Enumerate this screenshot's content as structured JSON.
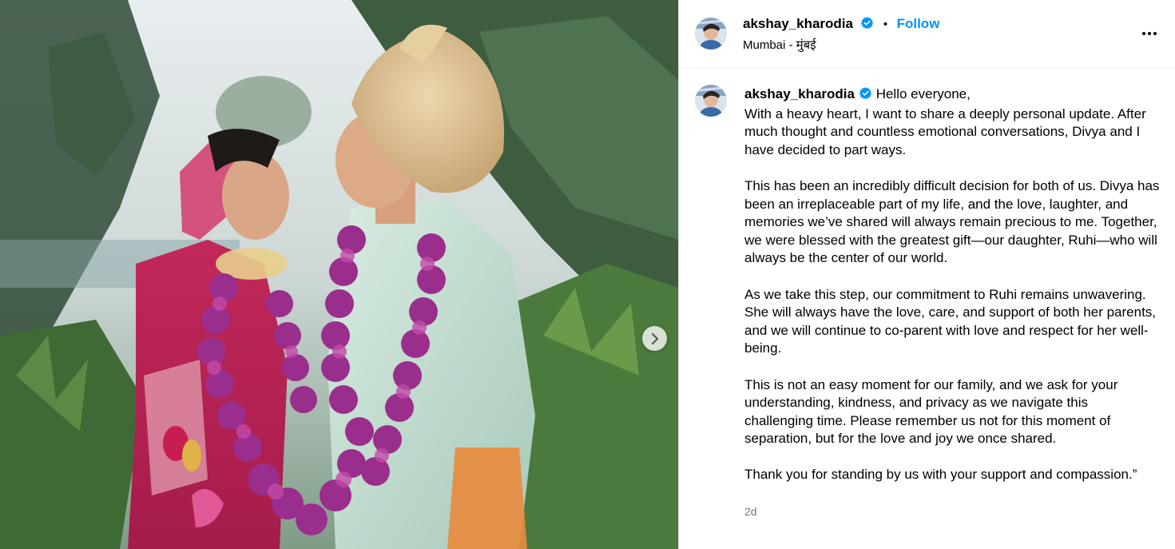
{
  "post": {
    "username": "akshay_kharodia",
    "verified_icon": "verified-badge-icon",
    "follow_label": "Follow",
    "separator": "•",
    "location": "Mumbai - मुंबई",
    "more_icon": "more-options-icon",
    "next_icon": "chevron-right-icon",
    "time": "2d",
    "caption_paragraphs": [
      "Hello everyone,\nWith a heavy heart, I want to share a deeply personal update. After much thought and countless emotional conversations, Divya and I have decided to part ways.",
      "This has been an incredibly difficult decision for both of us. Divya has been an irreplaceable part of my life, and the love, laughter, and memories we’ve shared will always remain precious to me. Together, we were blessed with the greatest gift—our daughter, Ruhi—who will always be the center of our world.",
      "As we take this step, our commitment to Ruhi remains unwavering. She will always have the love, care, and support of both her parents, and we will continue to co-parent with love and respect for her well-being.",
      "This is not an easy moment for our family, and we ask for your understanding, kindness, and privacy as we navigate this challenging time. Please remember us not for this moment of separation, but for the love and joy we once shared.",
      "Thank you for standing by us with your support and compassion.”"
    ]
  },
  "colors": {
    "follow": "#0095f6",
    "verified": "#0095f6",
    "muted": "#737373"
  }
}
